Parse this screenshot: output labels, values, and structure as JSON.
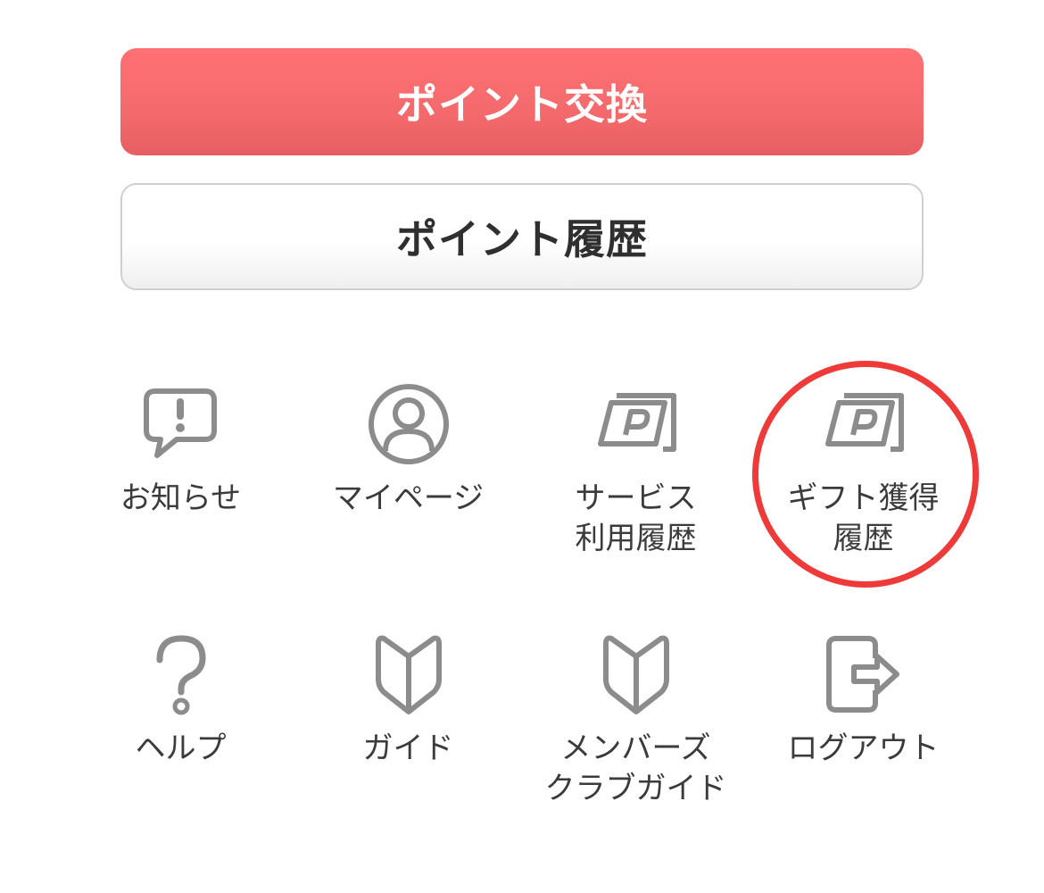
{
  "buttons": {
    "exchange_label": "ポイント交換",
    "history_label": "ポイント履歴"
  },
  "menu": {
    "items": [
      {
        "label": "お知らせ",
        "icon": "notice-icon"
      },
      {
        "label": "マイページ",
        "icon": "user-icon"
      },
      {
        "label": "サービス\n利用履歴",
        "icon": "point-card-icon"
      },
      {
        "label": "ギフト獲得\n履歴",
        "icon": "point-card-icon"
      },
      {
        "label": "ヘルプ",
        "icon": "question-icon"
      },
      {
        "label": "ガイド",
        "icon": "beginner-mark-icon"
      },
      {
        "label": "メンバーズ\nクラブガイド",
        "icon": "beginner-mark-icon"
      },
      {
        "label": "ログアウト",
        "icon": "logout-icon"
      }
    ]
  },
  "colors": {
    "primary": "#f46a6c",
    "icon_gray": "#8c8c8c",
    "highlight": "#ef3a3a"
  }
}
